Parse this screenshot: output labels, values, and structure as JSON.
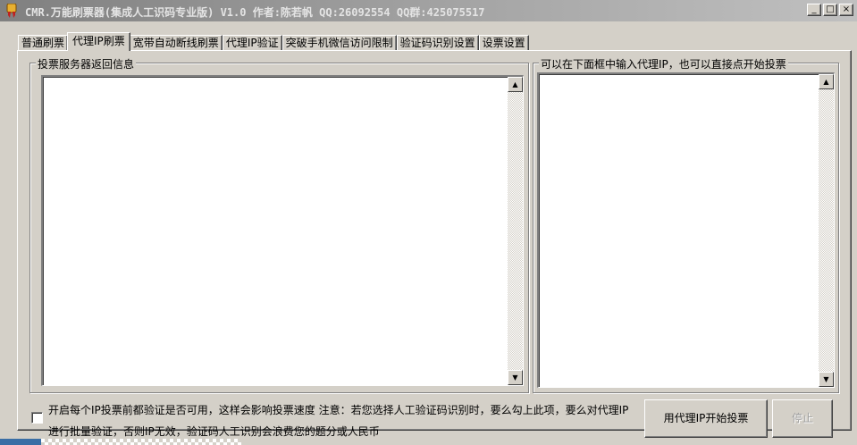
{
  "window": {
    "title": "CMR.万能刷票器(集成人工识码专业版) V1.0 作者:陈若帆 QQ:26092554 QQ群:425075517",
    "minimize_glyph": "_",
    "maximize_glyph": "□",
    "close_glyph": "×"
  },
  "tabs": [
    {
      "label": "普通刷票"
    },
    {
      "label": "代理IP刷票",
      "active": true
    },
    {
      "label": "宽带自动断线刷票"
    },
    {
      "label": "代理IP验证"
    },
    {
      "label": "突破手机微信访问限制"
    },
    {
      "label": "验证码识别设置"
    },
    {
      "label": "设票设置"
    }
  ],
  "left_panel": {
    "title": "投票服务器返回信息",
    "content": ""
  },
  "right_panel": {
    "title": "可以在下面框中输入代理IP，也可以直接点开始投票",
    "content": ""
  },
  "scroll": {
    "up_glyph": "▲",
    "down_glyph": "▼"
  },
  "verify_checkbox": {
    "checked": false,
    "line1": "开启每个IP投票前都验证是否可用，这样会影响投票速度 注意：若您选择人工验证码识别时，要么勾上此项，要么对代理IP",
    "line2": "进行批量验证，否则IP无效，验证码人工识别会浪费您的题分或人民币"
  },
  "buttons": {
    "start": "用代理IP开始投票",
    "stop": "停止"
  },
  "colors": {
    "window_bg": "#d4d0c8",
    "titlebar_inactive": "#808080",
    "taskbar_accent": "#3a6ea5"
  }
}
